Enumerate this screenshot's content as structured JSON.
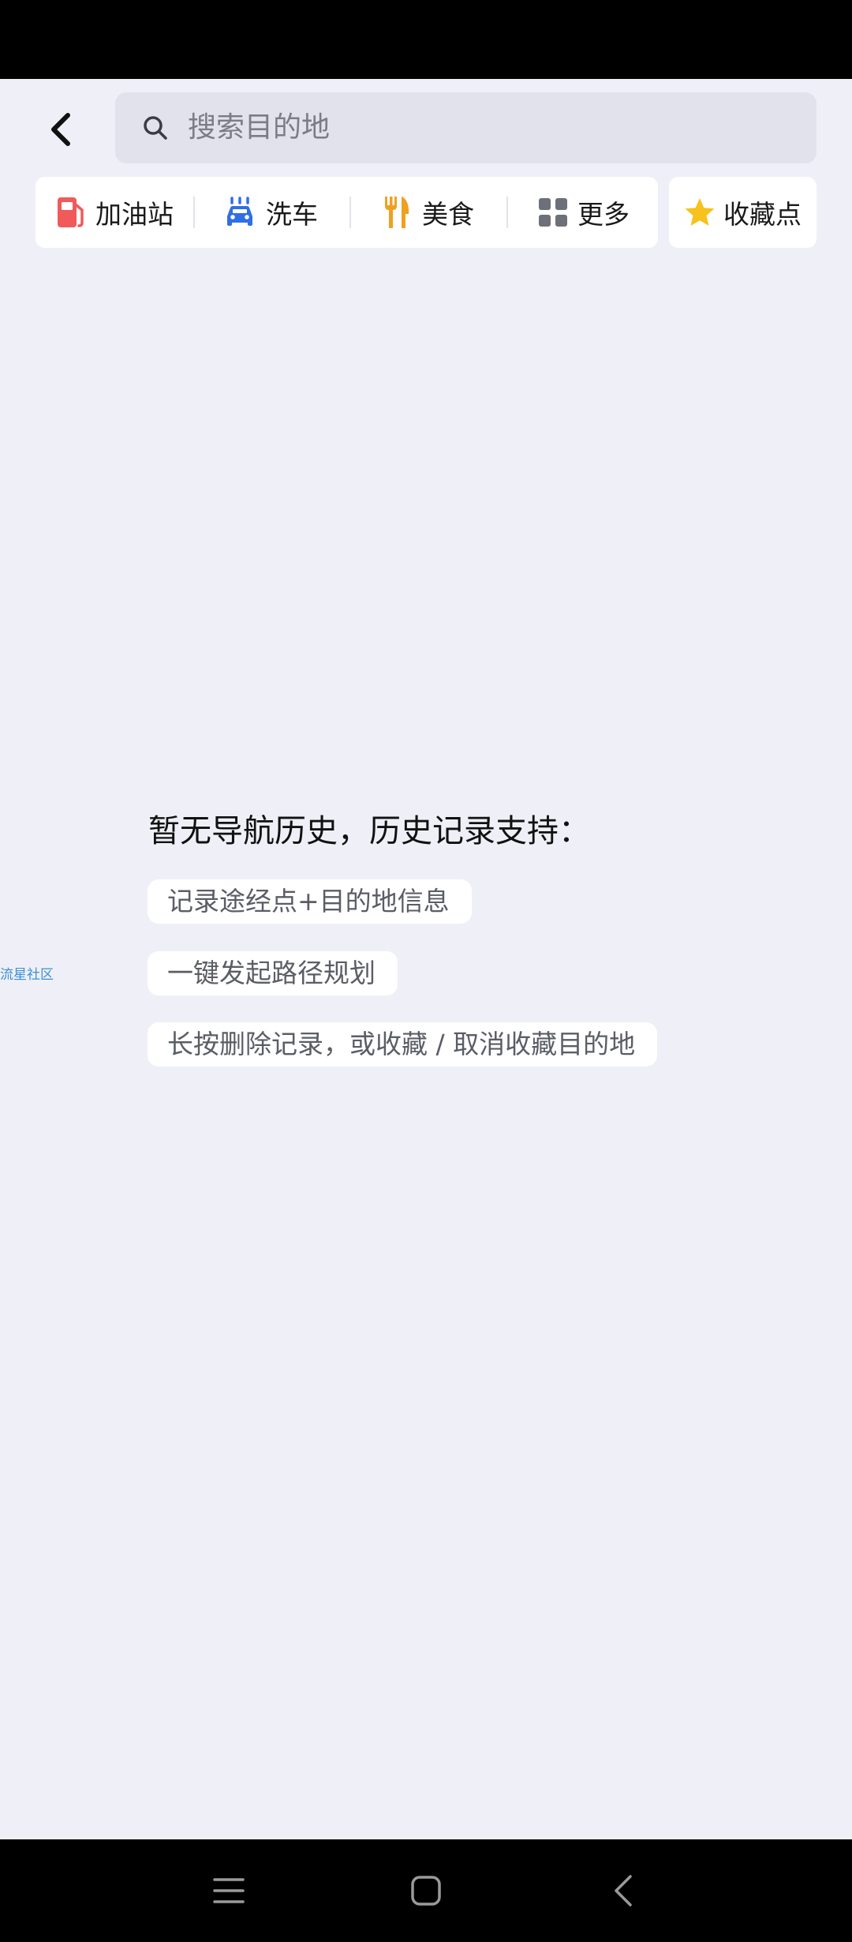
{
  "search": {
    "placeholder": "搜索目的地"
  },
  "categories": [
    {
      "label": "加油站",
      "icon": "fuel-pump-icon",
      "color": "#f05a5a"
    },
    {
      "label": "洗车",
      "icon": "car-wash-icon",
      "color": "#2f6fe6"
    },
    {
      "label": "美食",
      "icon": "fork-knife-icon",
      "color": "#f0a020"
    },
    {
      "label": "更多",
      "icon": "grid-icon",
      "color": "#6e7079"
    }
  ],
  "favorites": {
    "label": "收藏点",
    "icon": "star-icon",
    "color": "#f6c21b"
  },
  "empty_state": {
    "title": "暂无导航历史，历史记录支持：",
    "hints": [
      "记录途经点+目的地信息",
      "一键发起路径规划",
      "长按删除记录，或收藏 / 取消收藏目的地"
    ]
  },
  "watermark": "流星社区",
  "colors": {
    "background": "#eff0f7",
    "search_bg": "#e1e2eb",
    "card_bg": "#ffffff"
  }
}
